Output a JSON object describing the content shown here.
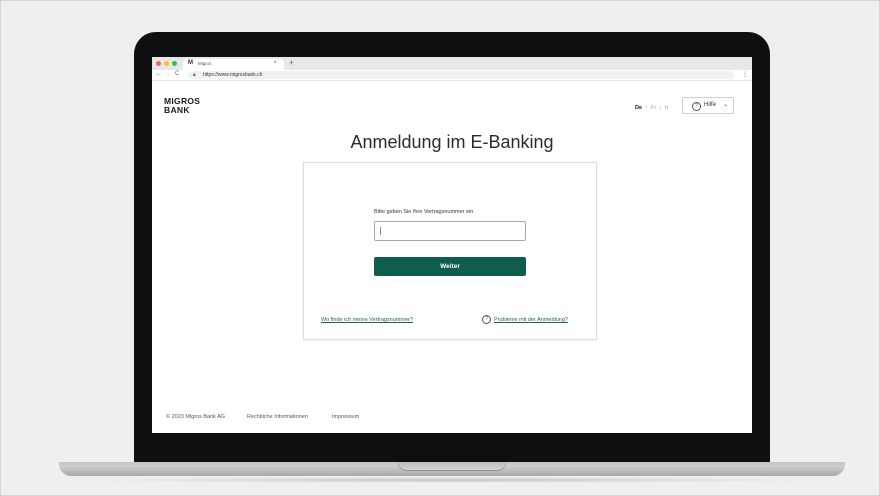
{
  "browser": {
    "tab_favicon": "M",
    "tab_title": "Migros",
    "tab_close": "×",
    "new_tab": "+",
    "back": "←",
    "forward": "→",
    "reload": "C",
    "url": "https://www.migrosbank.ch",
    "menu": "⋮",
    "traffic_lights": [
      "#ff5f57",
      "#febc2e",
      "#28c840"
    ]
  },
  "header": {
    "logo_line1": "MIGROS",
    "logo_line2": "BANK",
    "languages": [
      "De",
      "Fr",
      "It"
    ],
    "active_language": "De",
    "help_label": "Hilfe",
    "help_icon": "question-circle-icon"
  },
  "login": {
    "title": "Anmeldung im E-Banking",
    "field_label": "Bitte geben Sie Ihre Vertragsnummer ein",
    "field_value": "",
    "submit_label": "Weiter",
    "link_find_contract": "Wo finde ich meine Vertragsnummer?",
    "link_problems": "Probleme mit der Anmeldung?"
  },
  "footer": {
    "copyright": "© 2023 Migros Bank AG",
    "legal": "Rechtliche Informationen",
    "imprint": "Impressum"
  },
  "colors": {
    "brand_green": "#0f5d4b",
    "link_green": "#2b5f52"
  }
}
